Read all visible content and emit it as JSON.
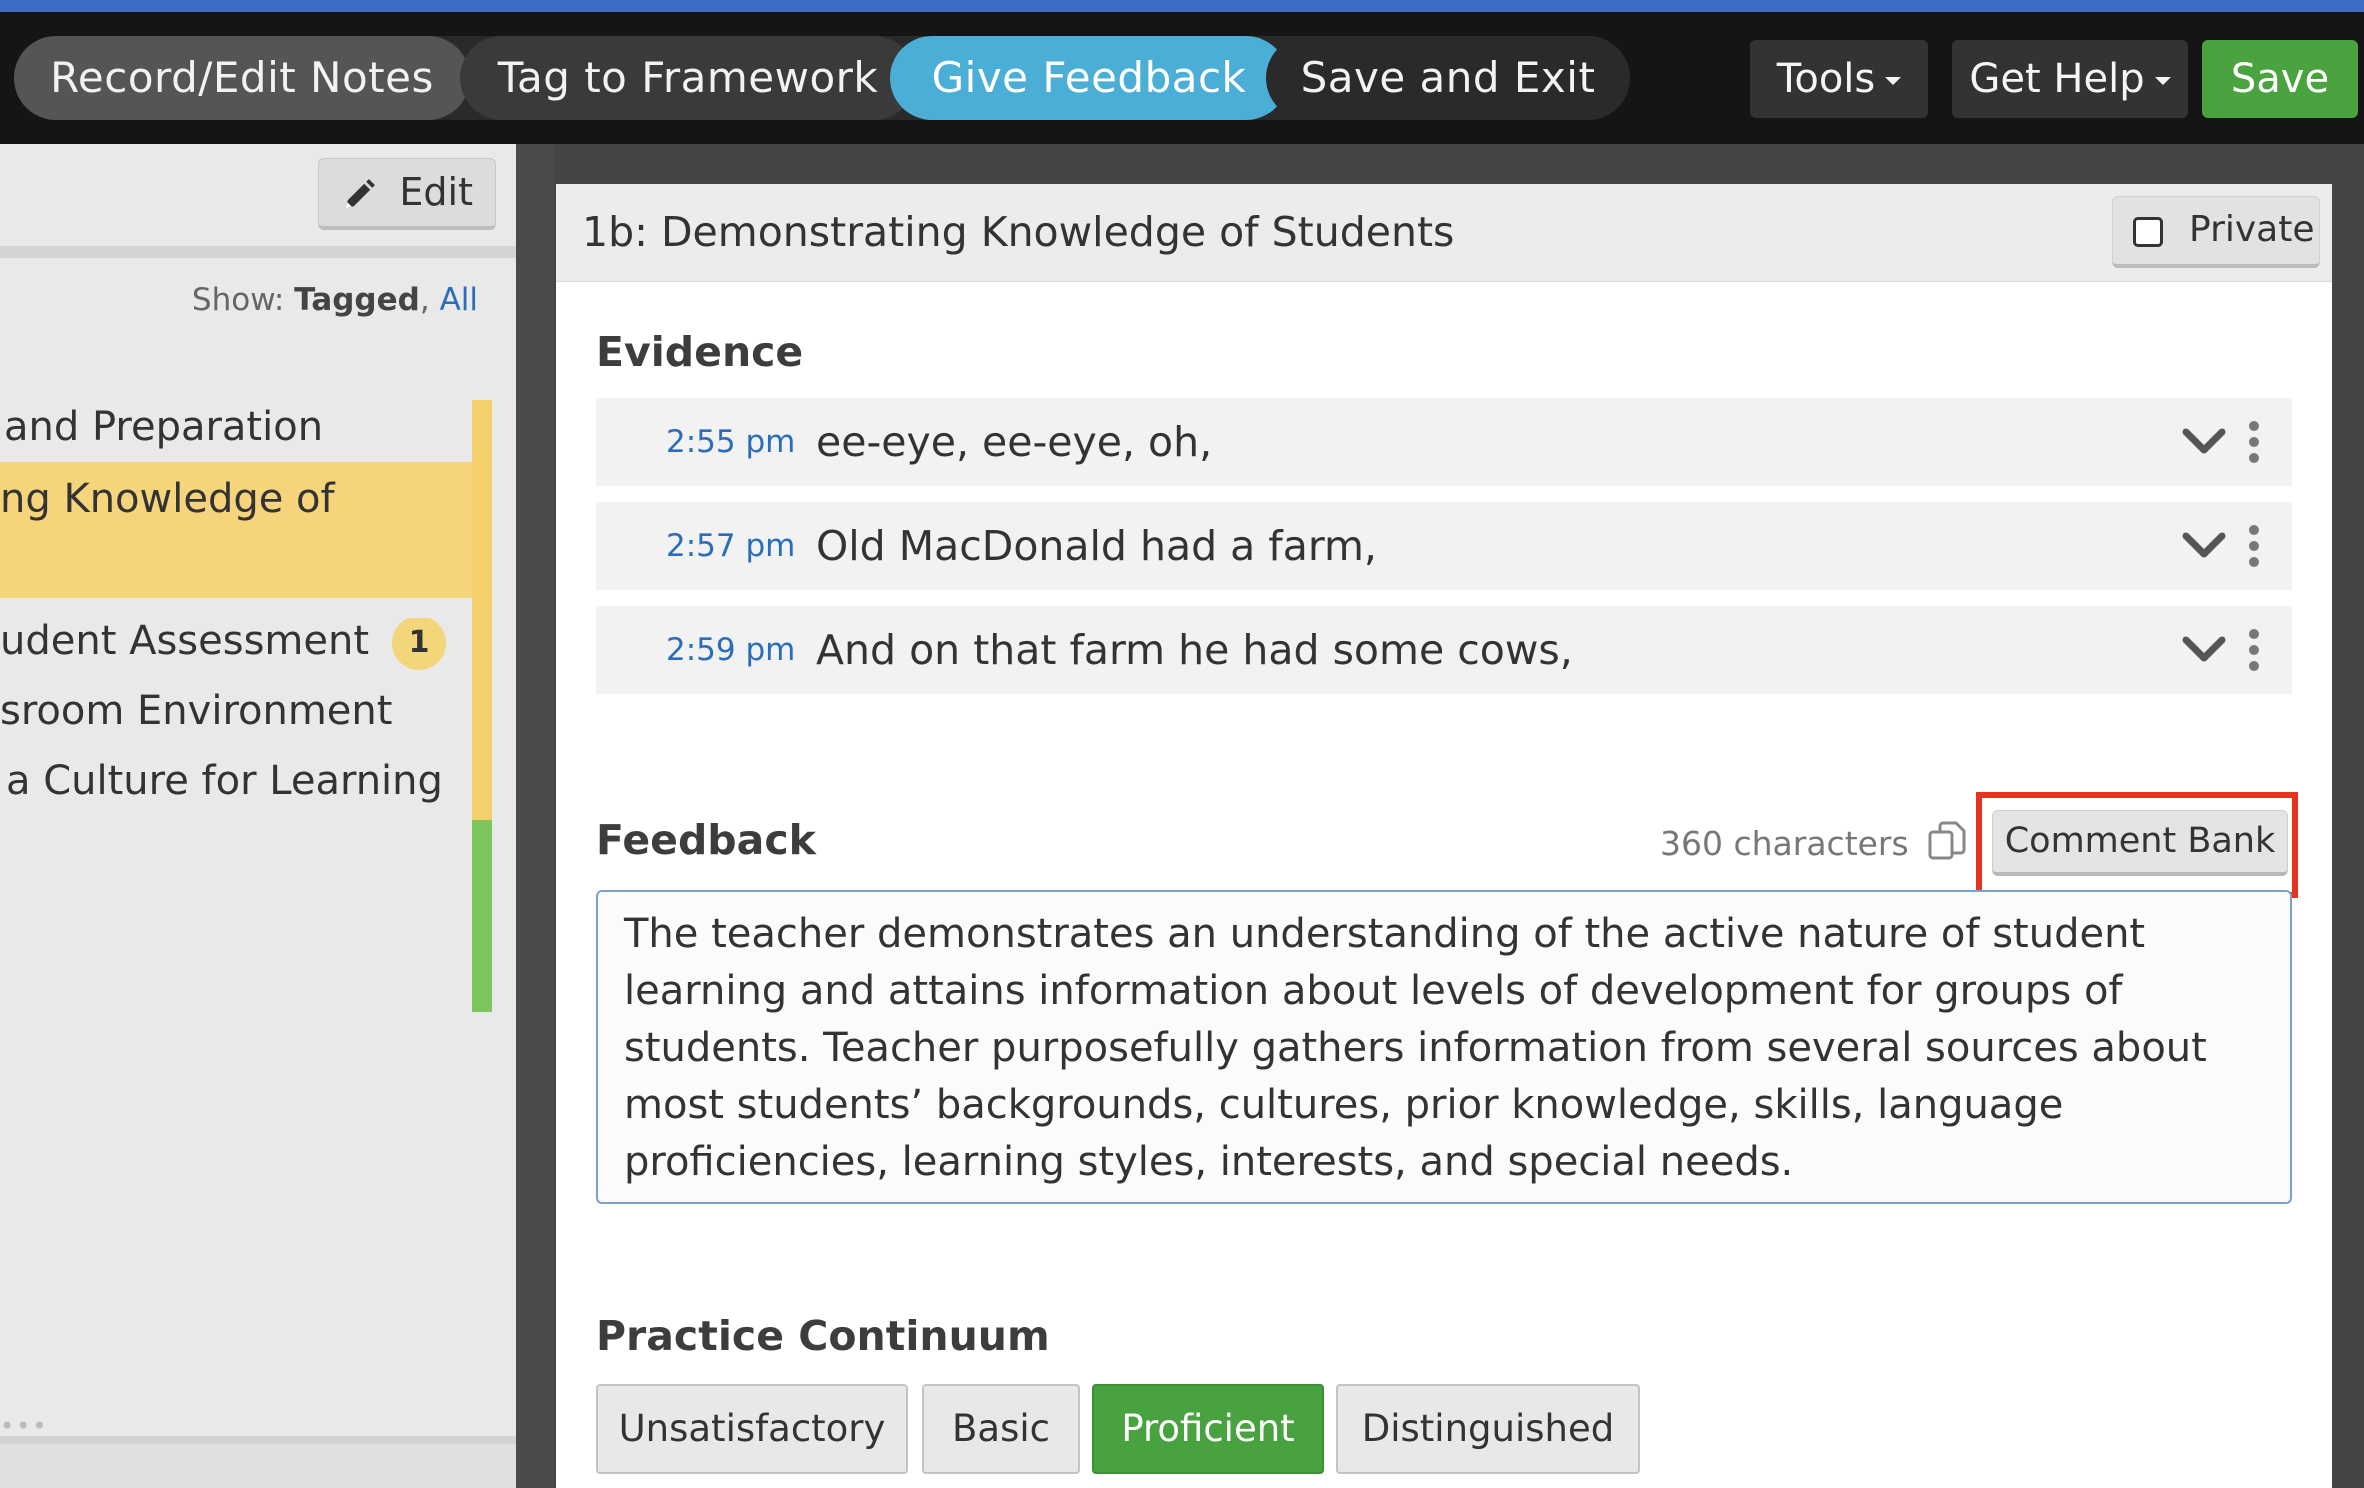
{
  "topbar": {
    "steps": [
      {
        "label": "Record/Edit Notes"
      },
      {
        "label": "Tag to Framework"
      },
      {
        "label": "Give Feedback"
      },
      {
        "label": "Save and Exit"
      }
    ],
    "tools_label": "Tools",
    "help_label": "Get Help",
    "save_label": "Save",
    "accent_color": "#3e6dc8",
    "active_step_color": "#4aaed6",
    "save_color": "#4aa33f"
  },
  "sidebar": {
    "edit_label": "Edit",
    "show_label": "Show:",
    "show_tagged": "Tagged",
    "show_sep": ",",
    "show_all": "All",
    "items": [
      {
        "label": "and Preparation"
      },
      {
        "label": "ng Knowledge of"
      },
      {
        "label": "udent Assessment",
        "badge": "1"
      },
      {
        "label": "sroom Environment"
      },
      {
        "label": "a Culture for Learning"
      }
    ],
    "dots": "•••",
    "highlight_color": "#f5d47c",
    "stripe_yellow": "#f3d06a",
    "stripe_green": "#7cc65c"
  },
  "card": {
    "title": "1b: Demonstrating Knowledge of Students",
    "private_label": "Private",
    "evidence_title": "Evidence",
    "evidence": [
      {
        "time": "2:55 pm",
        "text": "ee-eye, ee-eye, oh,"
      },
      {
        "time": "2:57 pm",
        "text": "Old MacDonald had a farm,"
      },
      {
        "time": "2:59 pm",
        "text": "And on that farm he had some cows,"
      }
    ],
    "feedback_title": "Feedback",
    "char_count": "360 characters",
    "comment_bank_label": "Comment Bank",
    "feedback_text": "The teacher demonstrates an understanding of the active nature of student learning and attains information about levels of development for groups of students. Teacher purposefully gathers information from several sources about most students’ backgrounds, cultures, prior knowledge, skills, language proficiencies, learning styles, interests, and special needs.",
    "practice_title": "Practice Continuum",
    "practice_options": [
      {
        "label": "Unsatisfactory"
      },
      {
        "label": "Basic"
      },
      {
        "label": "Proficient"
      },
      {
        "label": "Distinguished"
      }
    ],
    "practice_selected": "Proficient"
  }
}
